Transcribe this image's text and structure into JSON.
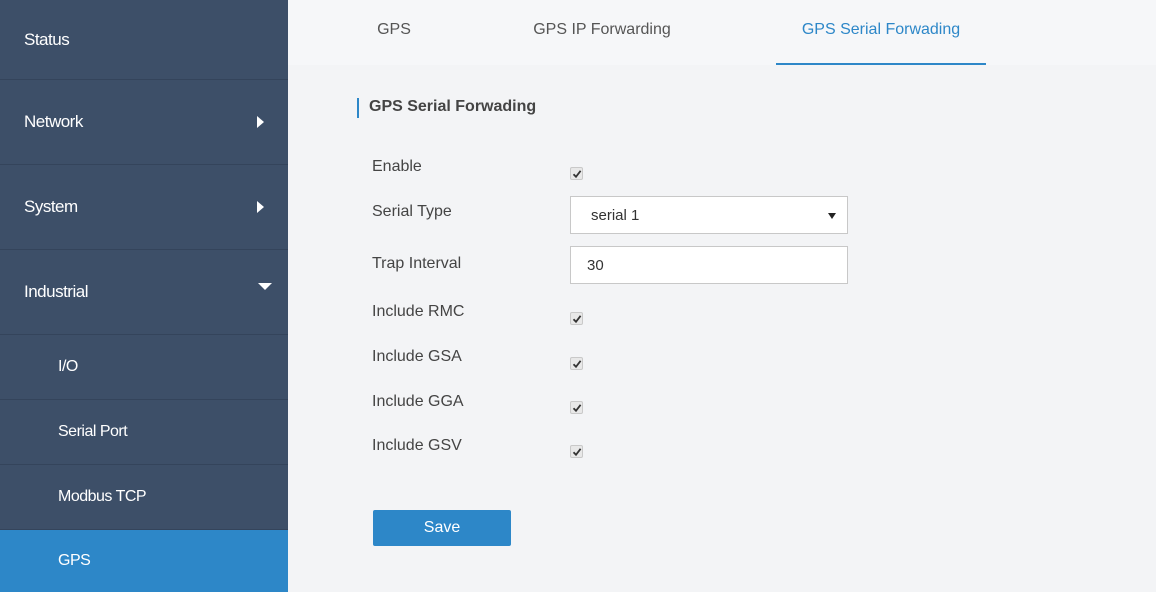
{
  "sidebar": {
    "items": [
      {
        "label": "Status"
      },
      {
        "label": "Network"
      },
      {
        "label": "System"
      },
      {
        "label": "Industrial"
      },
      {
        "label": "I/O"
      },
      {
        "label": "Serial Port"
      },
      {
        "label": "Modbus TCP"
      },
      {
        "label": "GPS"
      }
    ]
  },
  "tabs": [
    {
      "label": "GPS"
    },
    {
      "label": "GPS IP Forwarding"
    },
    {
      "label": "GPS Serial Forwading"
    }
  ],
  "section": {
    "title": "GPS Serial Forwading"
  },
  "form": {
    "enable": {
      "label": "Enable",
      "checked": true
    },
    "serial_type": {
      "label": "Serial Type",
      "value": "serial 1"
    },
    "trap_interval": {
      "label": "Trap Interval",
      "value": "30"
    },
    "include_rmc": {
      "label": "Include RMC",
      "checked": true
    },
    "include_gsa": {
      "label": "Include GSA",
      "checked": true
    },
    "include_gga": {
      "label": "Include GGA",
      "checked": true
    },
    "include_gsv": {
      "label": "Include GSV",
      "checked": true
    }
  },
  "buttons": {
    "save": "Save"
  },
  "colors": {
    "accent": "#2d87c8",
    "sidebar_bg": "#3d4f68"
  }
}
